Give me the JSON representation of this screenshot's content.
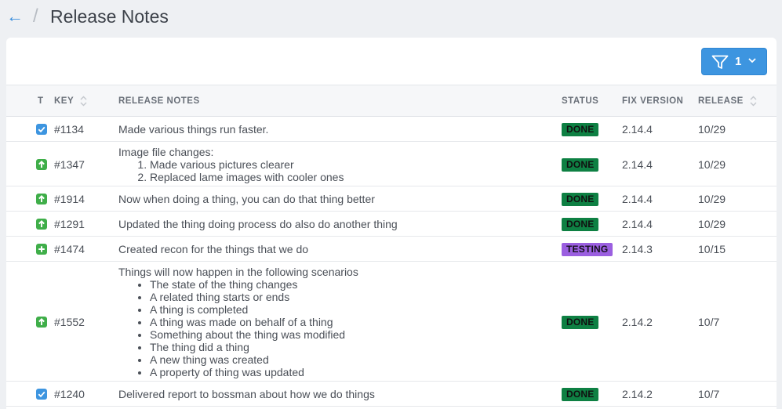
{
  "header": {
    "back_glyph": "←",
    "separator": "/",
    "title": "Release Notes"
  },
  "filter": {
    "count": "1",
    "icon": "funnel-icon",
    "color": "#3d95e0"
  },
  "columns": {
    "type": "T",
    "key": "KEY",
    "notes": "RELEASE NOTES",
    "status": "STATUS",
    "fix": "FIX VERSION",
    "release": "RELEASE"
  },
  "colors": {
    "done": "#0e8043",
    "testing": "#9b5fe0",
    "improvement": "#3fae49",
    "task": "#3d95e0"
  },
  "rows": [
    {
      "type": "task",
      "key": "#1134",
      "note": "Made various things run faster.",
      "status": "DONE",
      "fix": "2.14.4",
      "release": "10/29"
    },
    {
      "type": "improvement",
      "key": "#1347",
      "note": "Image file changes:",
      "sub": [
        "Made various pictures clearer",
        "Replaced lame images with cooler ones"
      ],
      "status": "DONE",
      "fix": "2.14.4",
      "release": "10/29"
    },
    {
      "type": "improvement",
      "key": "#1914",
      "note": "Now when doing a thing, you can do that thing better",
      "status": "DONE",
      "fix": "2.14.4",
      "release": "10/29"
    },
    {
      "type": "improvement",
      "key": "#1291",
      "note": "Updated the thing doing process do also do another thing",
      "status": "DONE",
      "fix": "2.14.4",
      "release": "10/29"
    },
    {
      "type": "new-feature",
      "key": "#1474",
      "note": "Created recon for the things that we do",
      "status": "TESTING",
      "fix": "2.14.3",
      "release": "10/15"
    },
    {
      "type": "improvement",
      "key": "#1552",
      "note": "Things will now happen in the following scenarios",
      "bullets": [
        "The state of the thing changes",
        "A related thing starts or ends",
        "A thing is completed",
        "A thing was made on behalf of a thing",
        "Something about the thing was modified",
        "The thing did a thing",
        "A new thing was created",
        "A property of thing was updated"
      ],
      "status": "DONE",
      "fix": "2.14.2",
      "release": "10/7"
    },
    {
      "type": "task",
      "key": "#1240",
      "note": "Delivered report to bossman about how we do things",
      "status": "DONE",
      "fix": "2.14.2",
      "release": "10/7"
    }
  ]
}
